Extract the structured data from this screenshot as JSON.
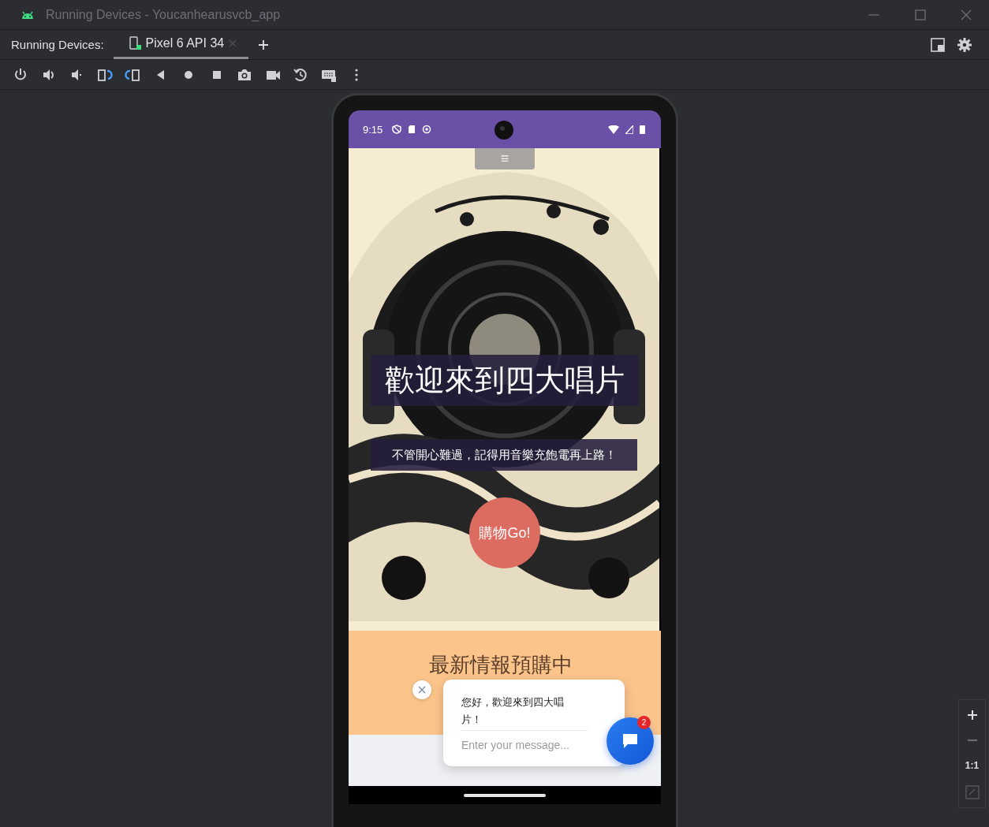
{
  "window": {
    "title": "Running Devices - Youcanhearusvcb_app"
  },
  "tool_window": {
    "label": "Running Devices:",
    "tabs": [
      {
        "label": "Pixel 6 API 34",
        "selected": true
      }
    ]
  },
  "device": {
    "status_bar": {
      "time": "9:15"
    },
    "menu_handle": "≡",
    "hero": {
      "kind": "picture",
      "title": "歡迎來到四大唱片",
      "subtitle": "不管開心難過，記得用音樂充飽電再上路！",
      "cta": "購物Go!"
    },
    "section": {
      "heading": "最新情報預購中"
    },
    "chat": {
      "message": "您好，歡迎來到四大唱片！",
      "placeholder": "Enter your message...",
      "badge": "2"
    }
  },
  "zoom_controls": {
    "actual_size": "1:1"
  }
}
